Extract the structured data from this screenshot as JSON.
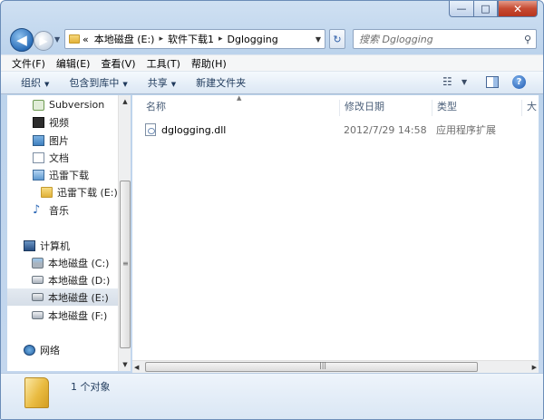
{
  "window": {
    "caption_buttons": {
      "minimize": "—",
      "maximize": "□",
      "close": "✕"
    }
  },
  "address": {
    "overflow": "«",
    "crumbs": [
      "本地磁盘 (E:)",
      "软件下载1",
      "Dglogging"
    ],
    "separator": "▸"
  },
  "search": {
    "placeholder": "搜索 Dglogging"
  },
  "menu": [
    "文件(F)",
    "编辑(E)",
    "查看(V)",
    "工具(T)",
    "帮助(H)"
  ],
  "toolbar": {
    "organize": "组织",
    "include_library": "包含到库中",
    "share": "共享",
    "new_folder": "新建文件夹"
  },
  "nav": {
    "items": [
      {
        "label": "Subversion",
        "icon": "subversion-icon"
      },
      {
        "label": "视频",
        "icon": "video-library-icon"
      },
      {
        "label": "图片",
        "icon": "pictures-library-icon"
      },
      {
        "label": "文档",
        "icon": "documents-library-icon"
      },
      {
        "label": "迅雷下载",
        "icon": "download-library-icon"
      },
      {
        "label": "迅雷下载 (E:)",
        "icon": "folder-icon"
      },
      {
        "label": "音乐",
        "icon": "music-library-icon"
      },
      {
        "label": "计算机",
        "icon": "computer-icon"
      },
      {
        "label": "本地磁盘 (C:)",
        "icon": "system-drive-icon"
      },
      {
        "label": "本地磁盘 (D:)",
        "icon": "drive-icon"
      },
      {
        "label": "本地磁盘 (E:)",
        "icon": "drive-icon",
        "selected": true
      },
      {
        "label": "本地磁盘 (F:)",
        "icon": "drive-icon"
      },
      {
        "label": "网络",
        "icon": "network-icon"
      }
    ]
  },
  "columns": {
    "name": "名称",
    "modified": "修改日期",
    "type": "类型",
    "size": "大"
  },
  "files": [
    {
      "name": "dglogging.dll",
      "modified": "2012/7/29 14:58",
      "type": "应用程序扩展"
    }
  ],
  "status": {
    "count": "1 个对象"
  }
}
